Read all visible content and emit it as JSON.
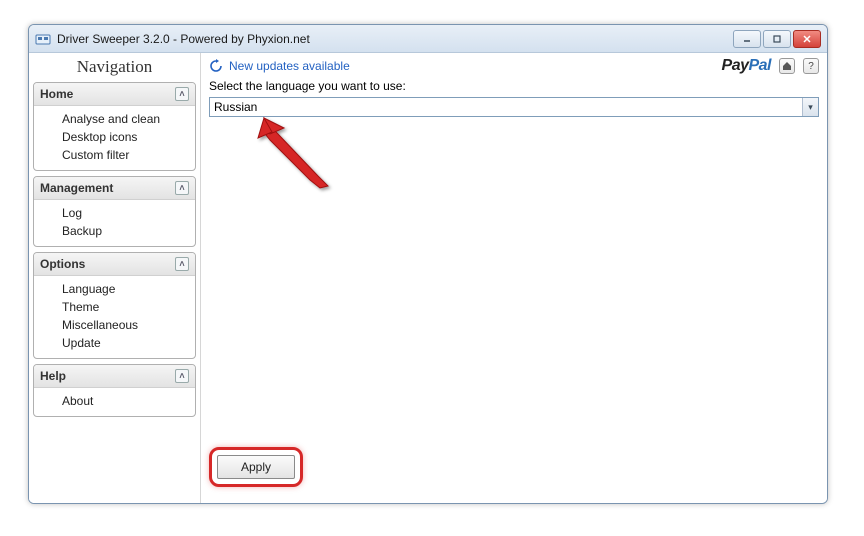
{
  "window": {
    "title": "Driver Sweeper 3.2.0 - Powered by Phyxion.net"
  },
  "sidebar": {
    "title": "Navigation",
    "groups": [
      {
        "label": "Home",
        "items": [
          "Analyse and clean",
          "Desktop icons",
          "Custom filter"
        ]
      },
      {
        "label": "Management",
        "items": [
          "Log",
          "Backup"
        ]
      },
      {
        "label": "Options",
        "items": [
          "Language",
          "Theme",
          "Miscellaneous",
          "Update"
        ]
      },
      {
        "label": "Help",
        "items": [
          "About"
        ]
      }
    ]
  },
  "topbar": {
    "update_link": "New updates available"
  },
  "language": {
    "label": "Select the language you want to use:",
    "selected": "Russian"
  },
  "buttons": {
    "apply": "Apply"
  }
}
